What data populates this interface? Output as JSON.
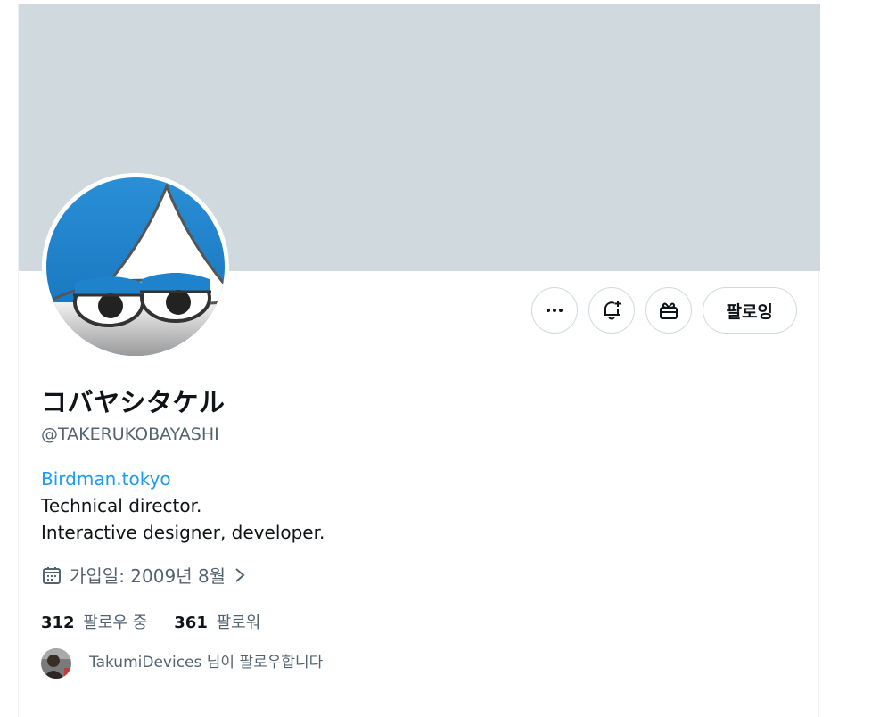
{
  "profile": {
    "display_name": "コバヤシタケル",
    "handle": "@TAKERUKOBAYASHI",
    "website": "Birdman.tokyo",
    "bio_lines": [
      "Technical director.",
      "Interactive designer, developer."
    ],
    "joined": "가입일: 2009년 8월"
  },
  "actions": {
    "more_icon": "more-horizontal-icon",
    "notify_icon": "bell-plus-icon",
    "gift_icon": "gift-icon",
    "follow_label": "팔로잉"
  },
  "stats": {
    "following_count": "312",
    "following_label": "팔로우 중",
    "followers_count": "361",
    "followers_label": "팔로워"
  },
  "followed_by": {
    "text": "TakumiDevices 님이 팔로우합니다"
  },
  "colors": {
    "banner": "#cfd9de",
    "link": "#1d9bf0",
    "secondary_text": "#536471",
    "primary_text": "#0f1419",
    "avatar_blue": "#1f82cc"
  }
}
